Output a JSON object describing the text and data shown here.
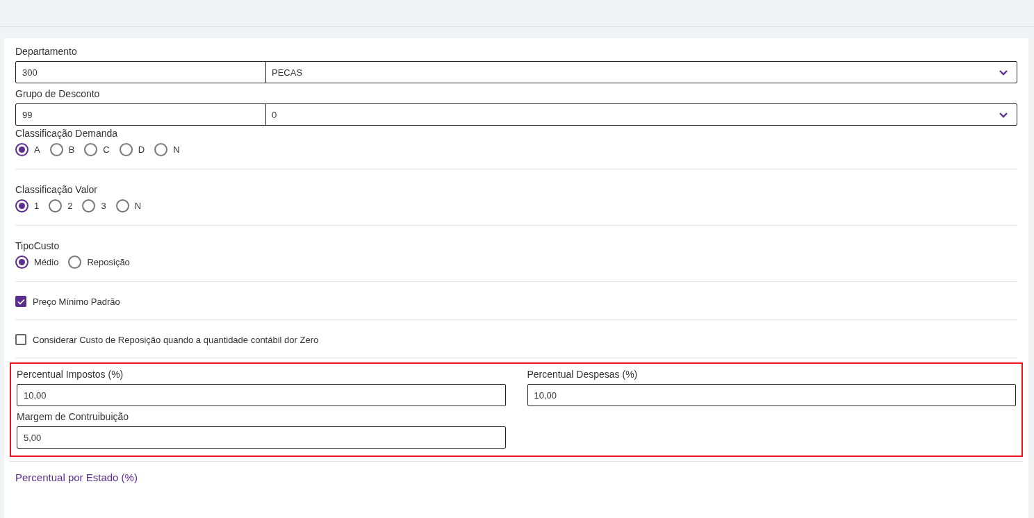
{
  "selects": [
    {
      "label": "Departamento",
      "code": "300",
      "value": "PECAS"
    },
    {
      "label": "Grupo de Desconto",
      "code": "99",
      "value": "0"
    }
  ],
  "radio_groups": [
    {
      "label": "Classificação Demanda",
      "options": [
        {
          "label": "A",
          "selected": true
        },
        {
          "label": "B",
          "selected": false
        },
        {
          "label": "C",
          "selected": false
        },
        {
          "label": "D",
          "selected": false
        },
        {
          "label": "N",
          "selected": false
        }
      ]
    },
    {
      "label": "Classificação Valor",
      "options": [
        {
          "label": "1",
          "selected": true
        },
        {
          "label": "2",
          "selected": false
        },
        {
          "label": "3",
          "selected": false
        },
        {
          "label": "N",
          "selected": false
        }
      ]
    },
    {
      "label": "TipoCusto",
      "options": [
        {
          "label": "Médio",
          "selected": true
        },
        {
          "label": "Reposição",
          "selected": false
        }
      ]
    }
  ],
  "checkboxes": [
    {
      "label": "Preço Mínimo Padrão",
      "checked": true
    },
    {
      "label": "Considerar Custo de Reposição quando a quantidade contábil dor Zero",
      "checked": false
    }
  ],
  "percent_section": {
    "highlighted": true,
    "fields": [
      {
        "label": "Percentual Impostos (%)",
        "value": "10,00"
      },
      {
        "label": "Percentual Despesas (%)",
        "value": "10,00"
      },
      {
        "label": "Margem de Contruibuição",
        "value": "5,00"
      }
    ]
  },
  "section_title": "Percentual por Estado (%)"
}
